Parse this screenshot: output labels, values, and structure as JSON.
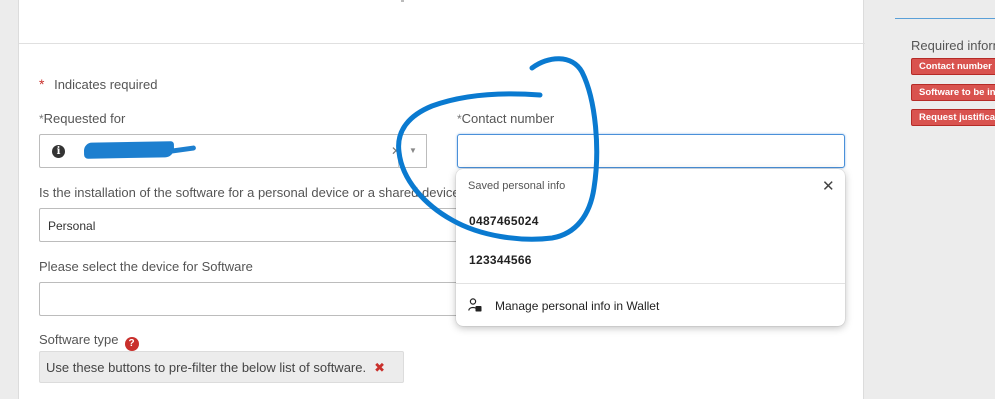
{
  "form": {
    "required_note": "Indicates required",
    "star": "*",
    "requested_for": {
      "label": "Requested for"
    },
    "contact_number": {
      "label": "Contact number",
      "value": ""
    },
    "installation_question": {
      "label": "Is the installation of the software for a personal device or a shared device",
      "selected": "Personal"
    },
    "device": {
      "label": "Please select the device for Software",
      "value": ""
    },
    "software_type": {
      "label": "Software type",
      "filter_hint": "Use these buttons to pre-filter the below list of software."
    }
  },
  "autofill_popup": {
    "header": "Saved personal info",
    "items": [
      "0487465024",
      "123344566"
    ],
    "manage_label": "Manage personal info in Wallet"
  },
  "required_info": {
    "title": "Required information",
    "tags": [
      "Contact number",
      "Software to be installed",
      "Request justification"
    ]
  },
  "colors": {
    "required_red": "#d9534f",
    "focus_blue": "#4a90d9",
    "annotation_blue": "#0a7ad0"
  },
  "icons": [
    "info-icon",
    "clear-x-icon",
    "reference-lookup-icon",
    "help-icon",
    "close-icon",
    "wallet-person-icon"
  ]
}
